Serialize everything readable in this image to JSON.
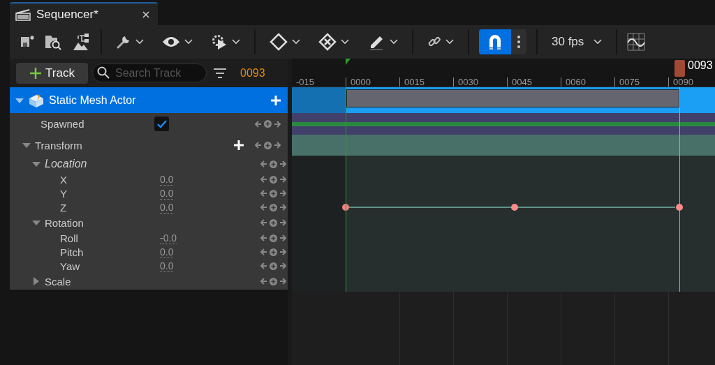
{
  "tab": {
    "title": "Sequencer*"
  },
  "toolbar": {
    "snap": {
      "on": true
    },
    "frame_rate": "30 fps"
  },
  "track_bar": {
    "add_label": "Track",
    "search": {
      "placeholder": "Search Track"
    },
    "current_frame": "0093"
  },
  "ruler": {
    "labels": [
      "-015",
      "0000",
      "0015",
      "0030",
      "0045",
      "0060",
      "0075",
      "0090"
    ],
    "playhead_label": "0093"
  },
  "tracks": [
    {
      "kind": "actor",
      "label": "Static Mesh Actor",
      "selected": true,
      "expanded": true,
      "add_button": true,
      "children": [
        {
          "kind": "bool",
          "label": "Spawned",
          "checked": true
        },
        {
          "kind": "group",
          "label": "Transform",
          "expanded": true,
          "add_button": true,
          "children": [
            {
              "kind": "group",
              "label": "Location",
              "expanded": true,
              "highlighted": true,
              "children": [
                {
                  "kind": "value",
                  "label": "X",
                  "value": "0.0"
                },
                {
                  "kind": "value",
                  "label": "Y",
                  "value": "0.0"
                },
                {
                  "kind": "value",
                  "label": "Z",
                  "value": "0.0"
                }
              ]
            },
            {
              "kind": "group",
              "label": "Rotation",
              "expanded": true,
              "highlighted": false,
              "children": [
                {
                  "kind": "value",
                  "label": "Roll",
                  "value": "-0.0"
                },
                {
                  "kind": "value",
                  "label": "Pitch",
                  "value": "0.0"
                },
                {
                  "kind": "value",
                  "label": "Yaw",
                  "value": "0.0"
                }
              ]
            },
            {
              "kind": "group",
              "label": "Scale",
              "expanded": false,
              "highlighted": false
            }
          ]
        }
      ]
    }
  ]
}
